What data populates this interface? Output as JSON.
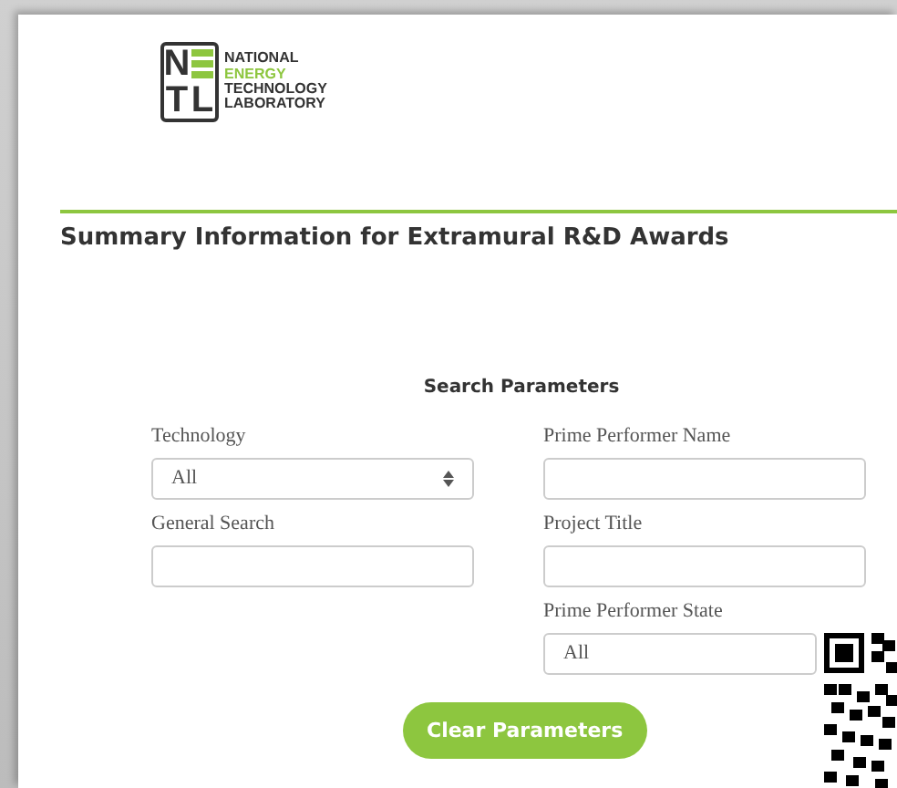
{
  "logo": {
    "letters": [
      "N",
      "T",
      "L"
    ],
    "lines": [
      {
        "text": "NATIONAL",
        "accent": false
      },
      {
        "text": "ENERGY",
        "accent": true
      },
      {
        "text": "TECHNOLOGY",
        "accent": false
      },
      {
        "text": "LABORATORY",
        "accent": false
      }
    ]
  },
  "title": "Summary Information for Extramural R&D Awards",
  "search": {
    "heading": "Search Parameters",
    "columns": [
      [
        {
          "label": "Technology",
          "kind": "select",
          "value": "All",
          "caret": true
        },
        {
          "label": "General Search",
          "kind": "text"
        }
      ],
      [
        {
          "label": "Prime Performer Name",
          "kind": "text"
        },
        {
          "label": "Project Title",
          "kind": "text"
        },
        {
          "label": "Prime Performer State",
          "kind": "select",
          "value": "All"
        }
      ]
    ]
  },
  "button": "Clear Parameters"
}
